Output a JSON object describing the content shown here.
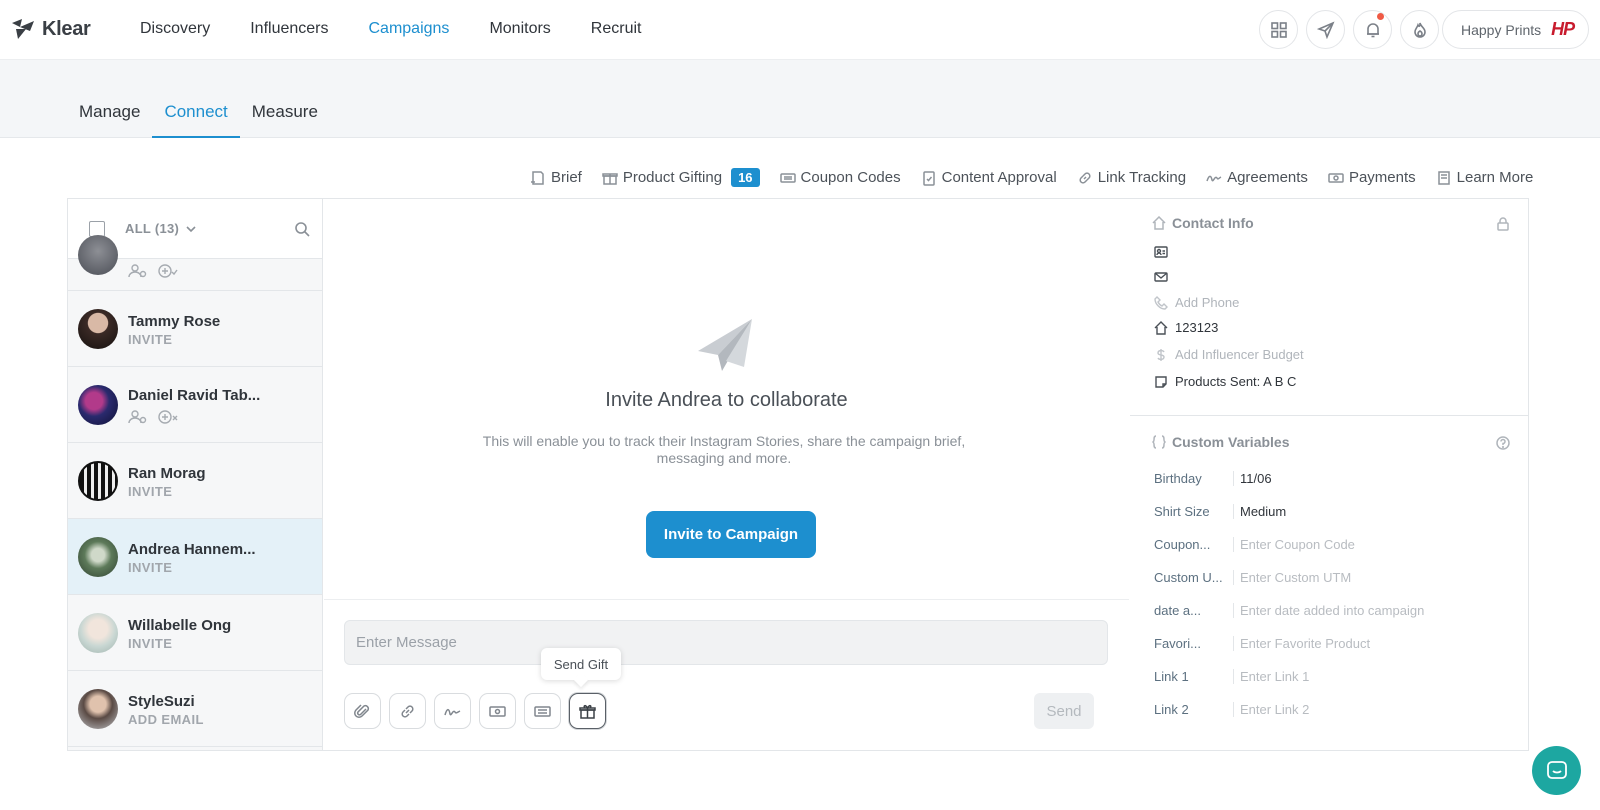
{
  "brand": {
    "name": "Klear"
  },
  "nav": {
    "items": [
      "Discovery",
      "Influencers",
      "Campaigns",
      "Monitors",
      "Recruit"
    ],
    "active": "Campaigns"
  },
  "account": {
    "name": "Happy Prints",
    "logo_text": "HP"
  },
  "subtabs": {
    "items": [
      "Manage",
      "Connect",
      "Measure"
    ],
    "active": "Connect"
  },
  "toolbar": {
    "brief": "Brief",
    "gifting": "Product Gifting",
    "gifting_count": "16",
    "coupons": "Coupon Codes",
    "approval": "Content Approval",
    "links": "Link Tracking",
    "agreements": "Agreements",
    "payments": "Payments",
    "learn": "Learn More"
  },
  "list": {
    "filter_label": "ALL (13)",
    "rows": [
      {
        "name": "Tammy Rose",
        "status": "INVITE"
      },
      {
        "name": "Daniel Ravid Tab...",
        "status": ""
      },
      {
        "name": "Ran Morag",
        "status": "INVITE"
      },
      {
        "name": "Andrea Hannem...",
        "status": "INVITE"
      },
      {
        "name": "Willabelle Ong",
        "status": "INVITE"
      },
      {
        "name": "StyleSuzi",
        "status": "ADD EMAIL"
      }
    ]
  },
  "center": {
    "title": "Invite Andrea to collaborate",
    "description": "This will enable you to track their Instagram Stories, share the campaign brief, messaging and more.",
    "invite_button": "Invite to Campaign",
    "message_placeholder": "Enter Message",
    "tooltip": "Send Gift",
    "send_label": "Send"
  },
  "contact": {
    "title": "Contact Info",
    "add_phone": "Add Phone",
    "address": "123123",
    "add_budget": "Add Influencer Budget",
    "products_sent": "Products Sent: A B C"
  },
  "custom_vars": {
    "title": "Custom Variables",
    "rows": [
      {
        "label": "Birthday",
        "value": "11/06",
        "placeholder": false
      },
      {
        "label": "Shirt Size",
        "value": "Medium",
        "placeholder": false
      },
      {
        "label": "Coupon...",
        "value": "Enter Coupon Code",
        "placeholder": true
      },
      {
        "label": "Custom U...",
        "value": "Enter Custom UTM",
        "placeholder": true
      },
      {
        "label": "date a...",
        "value": "Enter date added into campaign",
        "placeholder": true
      },
      {
        "label": "Favori...",
        "value": "Enter Favorite Product",
        "placeholder": true
      },
      {
        "label": "Link 1",
        "value": "Enter Link 1",
        "placeholder": true
      },
      {
        "label": "Link 2",
        "value": "Enter Link 2",
        "placeholder": true
      }
    ]
  },
  "colors": {
    "accent": "#1d8fcf",
    "selected_row": "#e4f1f8",
    "chat": "#1da7a1",
    "notif": "#ef5a45",
    "hp_red": "#c81b2d"
  }
}
